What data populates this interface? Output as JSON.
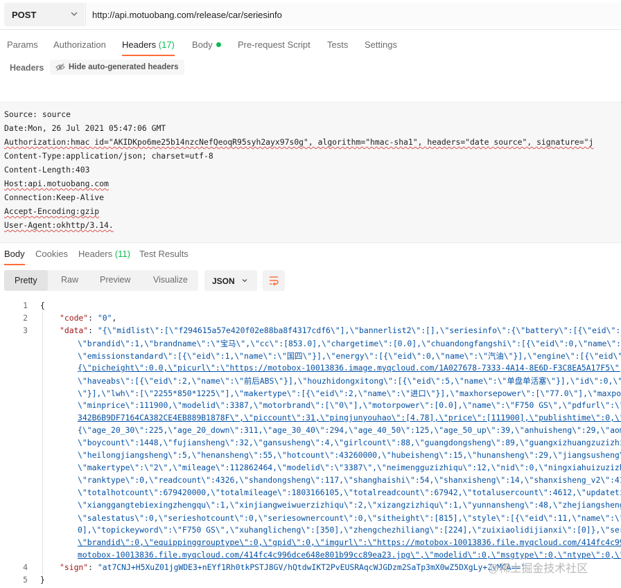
{
  "request": {
    "method": "POST",
    "url": "http://api.motuobang.com/release/car/seriesinfo"
  },
  "request_tabs": {
    "params": "Params",
    "authorization": "Authorization",
    "headers": "Headers",
    "headers_count": "(17)",
    "body": "Body",
    "prerequest": "Pre-request Script",
    "tests": "Tests",
    "settings": "Settings"
  },
  "headers_bar": {
    "title": "Headers",
    "hide_button": "Hide auto-generated headers"
  },
  "raw_headers": [
    "Source: source",
    "Date:Mon, 26 Jul 2021 05:47:06 GMT",
    "Authorization:hmac id=\"AKIDKpo6me25b14nzcNefQeoqR95syh2ayx97s0g\", algorithm=\"hmac-sha1\", headers=\"date source\", signature=\"j",
    "Content-Type:application/json; charset=utf-8",
    "Content-Length:403",
    "Host:api.motuobang.com",
    "Connection:Keep-Alive",
    "Accept-Encoding:gzip",
    "User-Agent:okhttp/3.14."
  ],
  "response_tabs": {
    "body": "Body",
    "cookies": "Cookies",
    "headers": "Headers",
    "headers_count": "(11)",
    "test_results": "Test Results"
  },
  "format_tabs": {
    "pretty": "Pretty",
    "raw": "Raw",
    "preview": "Preview",
    "visualize": "Visualize",
    "language": "JSON"
  },
  "code": {
    "line1": "{",
    "code_key": "\"code\"",
    "code_val": "\"0\"",
    "data_key": "\"data\"",
    "data_lines": [
      "\"{\\\"midlist\\\":[\\\"f294615a57e420f02e88ba8f4317cdf6\\\"],\\\"bannerlist2\\\":[],\\\"seriesinfo\\\":{\\\"battery\\\":[{\\\"eid\\\":1,\\\"n",
      "\\\"brandid\\\":1,\\\"brandname\\\":\\\"宝马\\\",\\\"cc\\\":[853.0],\\\"chargetime\\\":[0.0],\\\"chuandongfangshi\\\":[{\\\"eid\\\":0,\\\"name\\\":\\\"链",
      "\\\"emissionstandard\\\":[{\\\"eid\\\":1,\\\"name\\\":\\\"国四\\\"}],\\\"energy\\\":[{\\\"eid\\\":0,\\\"name\\\":\\\"汽油\\\"}],\\\"engine\\\":[{\\\"eid\\\":0,",
      "{\\\"picheight\\\":0.0,\\\"picurl\\\":\\\"https://motobox-10013836.image.myqcloud.com/1A027678-7333-4A14-8E6D-F3C8EA5A17F5\\\",\\\"pi",
      "\\\"haveabs\\\":[{\\\"eid\\\":2,\\\"name\\\":\\\"前后ABS\\\"}],\\\"houzhidongxitong\\\":[{\\\"eid\\\":5,\\\"name\\\":\\\"单盘单活塞\\\"}],\\\"id\\\":0,\\\"jin",
      "\\\"}],\\\"lwh\\\":[\\\"2255*850*1225\\\"],\\\"makertype\\\":[{\\\"eid\\\":2,\\\"name\\\":\\\"进口\\\"}],\\\"maxhorsepower\\\":[\\\"77.0\\\"],\\\"maxpower\\",
      "\\\"minprice\\\":111900,\\\"modelid\\\":3387,\\\"motorbrand\\\":[\\\"0\\\"],\\\"motorpower\\\":[0.0],\\\"name\\\":\\\"F750 GS\\\",\\\"pdfurl\\\":\\\"http",
      "342B6B9DF7164CA382CE4EB889B1878F\\\",\\\"piccount\\\":31,\\\"pingjunyouhao\\\":[4.78],\\\"price\\\":[111900],\\\"publishtime\\\":0,\\\"qian",
      "{\\\"age_20_30\\\":225,\\\"age_20_down\\\":311,\\\"age_30_40\\\":294,\\\"age_40_50\\\":125,\\\"age_50_up\\\":39,\\\"anhuisheng\\\":29,\\\"aomente",
      "\\\"boycount\\\":1448,\\\"fujiansheng\\\":32,\\\"gansusheng\\\":4,\\\"girlcount\\\":88,\\\"guangdongsheng\\\":89,\\\"guangxizhuangzuzizhiqu\\",
      "\\\"heilongjiangsheng\\\":5,\\\"henansheng\\\":55,\\\"hotcount\\\":43260000,\\\"hubeisheng\\\":15,\\\"hunansheng\\\":29,\\\"jiangsusheng\\\":10",
      "\\\"makertype\\\":\\\"2\\\",\\\"mileage\\\":112862464,\\\"modelid\\\":\\\"3387\\\",\\\"neimengguzizhiqu\\\":12,\\\"nid\\\":0,\\\"ningxiahuizuzizhiqu\\",
      "\\\"ranktype\\\":0,\\\"readcount\\\":4326,\\\"shandongsheng\\\":117,\\\"shanghaishi\\\":54,\\\"shanxisheng\\\":14,\\\"shanxisheng_v2\\\":41,\\\"s",
      "\\\"totalhotcount\\\":679420000,\\\"totalmileage\\\":1803166105,\\\"totalreadcount\\\":67942,\\\"totalusercount\\\":4612,\\\"updatetime\\",
      "\\\"xianggangtebiexingzhengqu\\\":1,\\\"xinjiangweiwuerzizhiqu\\\":2,\\\"xizangzizhiqu\\\":1,\\\"yunnansheng\\\":48,\\\"zhejiangsheng\\\":1",
      "\\\"salestatus\\\":0,\\\"serieshotcount\\\":0,\\\"seriesownercount\\\":0,\\\"sitheight\\\":[815],\\\"style\\\":[{\\\"eid\\\":11,\\\"name\\\":\\\"拉力",
      "0],\\\"topickeyword\\\":\\\"F750 GS\\\",\\\"xuhanglicheng\\\":[350],\\\"zhengchezhiliang\\\":[224],\\\"zuixiaolidijianxi\\\":[0]},\\\"seriesn",
      "\\\"brandid\\\":0,\\\"equippinggrouptype\\\":0,\\\"gpid\\\":0,\\\"imgurl\\\":\\\"https://motobox-10013836.file.myqcloud.com/414fc4c996dce",
      "motobox-10013836.file.myqcloud.com/414fc4c996dce648e801b99cc89ea23.jpg\\\",\\\"modelid\\\":0,\\\"msgtype\\\":0,\\\"ntype\\\":0,\\\"orde"
    ],
    "sign_key": "\"sign\"",
    "sign_val": "\"at7CNJ+H5XuZ01jgWDE3+nEYf1Rh0tkPSTJ8GV/hQtdwIKT2PvEUSRAqcWJGDzm2SaTp3mX0wZ5DXgLy+ZvMCA==\"",
    "line5": "}",
    "line_numbers": [
      "1",
      "2",
      "3",
      "4",
      "5"
    ]
  },
  "watermark": "@稀土掘金技术社区"
}
